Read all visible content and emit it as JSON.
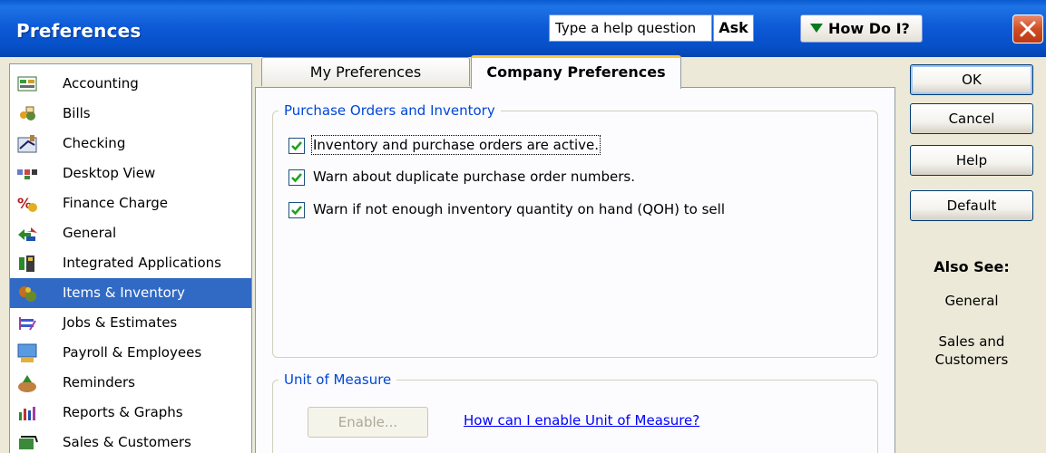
{
  "window": {
    "title": "Preferences",
    "help_question": "Type a help question",
    "ask_label": "Ask",
    "how_do_i_label": "How Do I?"
  },
  "categories": [
    {
      "label": "Accounting",
      "icon": "accounting-icon"
    },
    {
      "label": "Bills",
      "icon": "bills-icon"
    },
    {
      "label": "Checking",
      "icon": "checking-icon"
    },
    {
      "label": "Desktop View",
      "icon": "desktop-view-icon"
    },
    {
      "label": "Finance Charge",
      "icon": "finance-charge-icon"
    },
    {
      "label": "General",
      "icon": "general-icon"
    },
    {
      "label": "Integrated Applications",
      "icon": "integrated-applications-icon"
    },
    {
      "label": "Items & Inventory",
      "icon": "items-inventory-icon",
      "selected": true
    },
    {
      "label": "Jobs & Estimates",
      "icon": "jobs-estimates-icon"
    },
    {
      "label": "Payroll & Employees",
      "icon": "payroll-employees-icon"
    },
    {
      "label": "Reminders",
      "icon": "reminders-icon"
    },
    {
      "label": "Reports & Graphs",
      "icon": "reports-graphs-icon"
    },
    {
      "label": "Sales & Customers",
      "icon": "sales-customers-icon"
    }
  ],
  "tabs": {
    "my_preferences": "My Preferences",
    "company_preferences": "Company Preferences",
    "active": "company_preferences"
  },
  "purchase_orders": {
    "legend": "Purchase Orders and Inventory",
    "options": [
      {
        "label": "Inventory and purchase orders are active.",
        "checked": true
      },
      {
        "label": "Warn about duplicate purchase order numbers.",
        "checked": true
      },
      {
        "label": "Warn if not enough inventory quantity on hand (QOH) to sell",
        "checked": true
      }
    ]
  },
  "unit_of_measure": {
    "legend": "Unit of Measure",
    "enable_label": "Enable...",
    "enable_disabled": true,
    "help_link": "How can I enable Unit of Measure?"
  },
  "buttons": {
    "ok": "OK",
    "cancel": "Cancel",
    "help": "Help",
    "default": "Default"
  },
  "also_see": {
    "title": "Also See:",
    "general": "General",
    "sales_line1": "Sales and",
    "sales_line2": "Customers"
  },
  "colors": {
    "title_bar": "#0A5BD0",
    "selection": "#316AC5",
    "group_legend": "#0046D5",
    "link": "#0000FF",
    "tab_highlight": "#FFC83C"
  }
}
